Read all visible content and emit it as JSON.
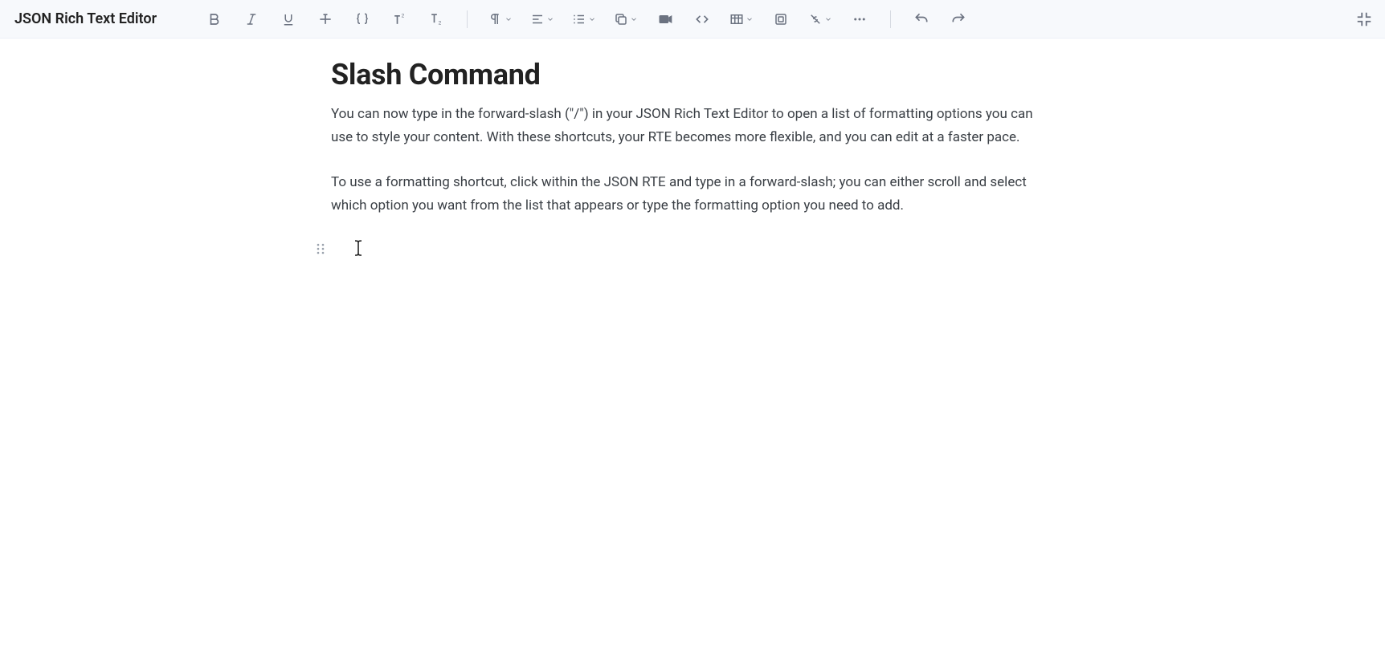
{
  "header": {
    "title": "JSON Rich Text Editor"
  },
  "toolbar": {
    "icons": {
      "bold": "bold-icon",
      "italic": "italic-icon",
      "underline": "underline-icon",
      "strikethrough": "strikethrough-icon",
      "code": "code-braces-icon",
      "superscript": "superscript-icon",
      "subscript": "subscript-icon",
      "paragraph": "paragraph-icon",
      "align": "align-left-icon",
      "list": "list-ordered-icon",
      "copy": "copy-icon",
      "video": "video-icon",
      "embed": "code-block-icon",
      "table": "table-icon",
      "frame": "frame-icon",
      "link": "broken-link-icon",
      "more": "more-icon",
      "undo": "undo-icon",
      "redo": "redo-icon",
      "collapse": "collapse-icon"
    }
  },
  "document": {
    "heading": "Slash Command",
    "p1": "You can now type in the forward-slash (\"/\") in your JSON Rich Text Editor to open a list of formatting options you can use to style your content. With these shortcuts, your RTE becomes more flexible, and you can edit at a faster pace.",
    "p2": "To use a formatting shortcut, click within the JSON RTE and type in a forward-slash; you can either scroll and select which option you want from the list that appears or type the formatting option you need to add."
  }
}
